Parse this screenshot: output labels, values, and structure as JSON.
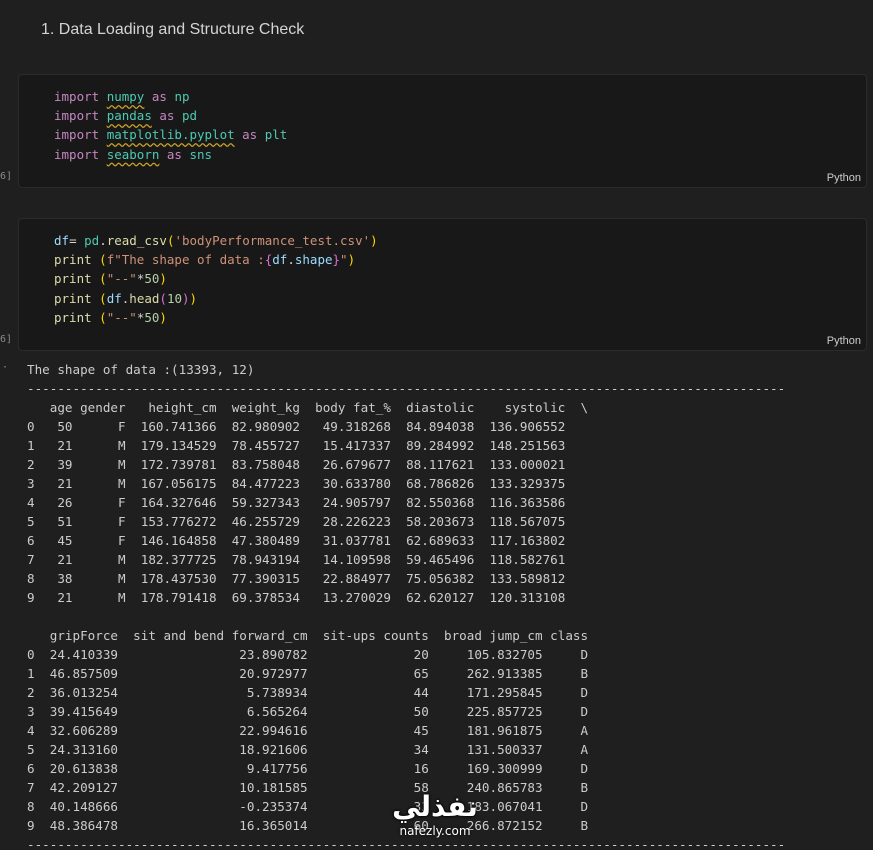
{
  "heading": "1. Data Loading and Structure Check",
  "cells": [
    {
      "exec_label": "6]",
      "language": "Python",
      "code": [
        [
          [
            "import ",
            "kw"
          ],
          [
            "numpy",
            "mod"
          ],
          [
            " as ",
            "kw"
          ],
          [
            "np",
            "al"
          ]
        ],
        [
          [
            "import ",
            "kw"
          ],
          [
            "pandas",
            "mod"
          ],
          [
            " as ",
            "kw"
          ],
          [
            "pd",
            "al"
          ]
        ],
        [
          [
            "import ",
            "kw"
          ],
          [
            "matplotlib.pyplot",
            "mod"
          ],
          [
            " as ",
            "kw"
          ],
          [
            "plt",
            "al"
          ]
        ],
        [
          [
            "import ",
            "kw"
          ],
          [
            "seaborn",
            "mod"
          ],
          [
            " as ",
            "kw"
          ],
          [
            "sns",
            "al"
          ]
        ]
      ]
    },
    {
      "exec_label": "6]",
      "language": "Python",
      "code": [
        [
          [
            "df",
            "var"
          ],
          [
            "= ",
            "op"
          ],
          [
            "pd",
            "al"
          ],
          [
            ".",
            "op"
          ],
          [
            "read_csv",
            "fn"
          ],
          [
            "(",
            "pu"
          ],
          [
            "'bodyPerformance_test.csv'",
            "str"
          ],
          [
            ")",
            "pu"
          ]
        ],
        [
          [
            "print",
            "fn"
          ],
          [
            " ",
            "op"
          ],
          [
            "(",
            "pu"
          ],
          [
            "f\"The shape of data :",
            "str"
          ],
          [
            "{",
            "pu2"
          ],
          [
            "df",
            "var"
          ],
          [
            ".",
            "op"
          ],
          [
            "shape",
            "var"
          ],
          [
            "}",
            "pu2"
          ],
          [
            "\"",
            "str"
          ],
          [
            ")",
            "pu"
          ]
        ],
        [
          [
            "print",
            "fn"
          ],
          [
            " ",
            "op"
          ],
          [
            "(",
            "pu"
          ],
          [
            "\"--\"",
            "str"
          ],
          [
            "*",
            "op"
          ],
          [
            "50",
            "num"
          ],
          [
            ")",
            "pu"
          ]
        ],
        [
          [
            "print",
            "fn"
          ],
          [
            " ",
            "op"
          ],
          [
            "(",
            "pu"
          ],
          [
            "df",
            "var"
          ],
          [
            ".",
            "op"
          ],
          [
            "head",
            "fn"
          ],
          [
            "(",
            "pu2"
          ],
          [
            "10",
            "num"
          ],
          [
            ")",
            "pu2"
          ],
          [
            ")",
            "pu"
          ]
        ],
        [
          [
            "print",
            "fn"
          ],
          [
            " ",
            "op"
          ],
          [
            "(",
            "pu"
          ],
          [
            "\"--\"",
            "str"
          ],
          [
            "*",
            "op"
          ],
          [
            "50",
            "num"
          ],
          [
            ")",
            "pu"
          ]
        ]
      ]
    }
  ],
  "output_marker": "·",
  "output": {
    "lines": [
      "The shape of data :(13393, 12)",
      "----------------------------------------------------------------------------------------------------",
      "   age gender   height_cm  weight_kg  body fat_%  diastolic    systolic  \\",
      "0   50      F  160.741366  82.980902   49.318268  84.894038  136.906552",
      "1   21      M  179.134529  78.455727   15.417337  89.284992  148.251563",
      "2   39      M  172.739781  83.758048   26.679677  88.117621  133.000021",
      "3   21      M  167.056175  84.477223   30.633780  68.786826  133.329375",
      "4   26      F  164.327646  59.327343   24.905797  82.550368  116.363586",
      "5   51      F  153.776272  46.255729   28.226223  58.203673  118.567075",
      "6   45      F  146.164858  47.380489   31.037781  62.689633  117.163802",
      "7   21      M  182.377725  78.943194   14.109598  59.465496  118.582761",
      "8   38      M  178.437530  77.390315   22.884977  75.056382  133.589812",
      "9   21      M  178.791418  69.378534   13.270029  62.620127  120.313108",
      "",
      "   gripForce  sit and bend forward_cm  sit-ups counts  broad jump_cm class",
      "0  24.410339                23.890782              20     105.832705     D",
      "1  46.857509                20.972977              65     262.913385     B",
      "2  36.013254                 5.738934              44     171.295845     D",
      "3  39.415649                 6.565264              50     225.857725     D",
      "4  32.606289                22.994616              45     181.961875     A",
      "5  24.313160                18.921606              34     131.500337     A",
      "6  20.613838                 9.417756              16     169.300999     D",
      "7  42.209127                10.181585              58     240.865783     B",
      "8  40.148666                -0.235374              33     183.067041     D",
      "9  48.386478                16.365014              60     266.872152     B",
      "----------------------------------------------------------------------------------------------------"
    ]
  },
  "watermark": {
    "logo": "نفذلي",
    "url": "nafezly.com"
  }
}
